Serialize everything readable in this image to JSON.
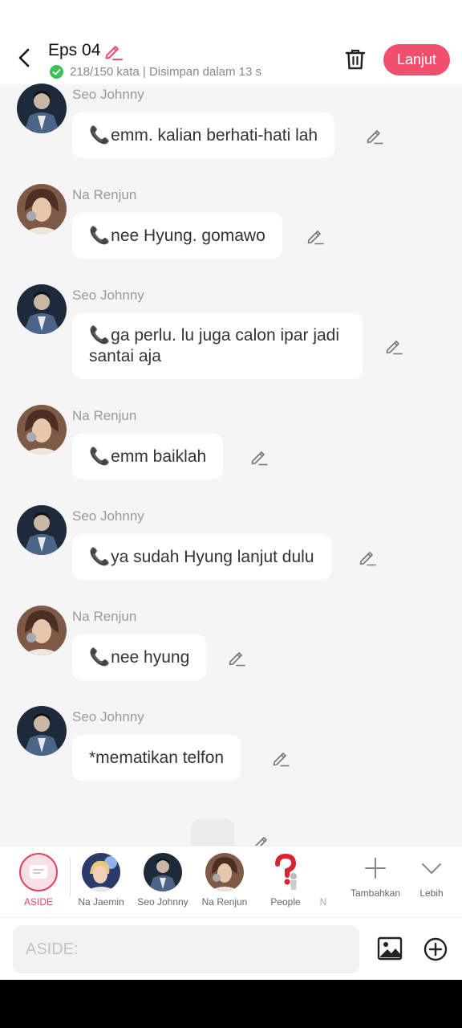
{
  "header": {
    "title": "Eps 04",
    "status": "218/150 kata | Disimpan dalam 13 s",
    "next_label": "Lanjut"
  },
  "messages": [
    {
      "sender": "Seo Johnny",
      "icon": "phone-emoji",
      "text": "emm. kalian berhati-hati lah"
    },
    {
      "sender": "Na Renjun",
      "icon": "phone-emoji",
      "text": "nee Hyung. gomawo"
    },
    {
      "sender": "Seo Johnny",
      "icon": "phone-emoji",
      "text": "ga perlu. lu juga calon ipar jadi santai aja"
    },
    {
      "sender": "Na Renjun",
      "icon": "phone-emoji",
      "text": "emm baiklah"
    },
    {
      "sender": "Seo Johnny",
      "icon": "phone-emoji",
      "text": "ya sudah Hyung lanjut dulu"
    },
    {
      "sender": "Na Renjun",
      "icon": "phone-emoji",
      "text": "nee hyung"
    },
    {
      "sender": "Seo Johnny",
      "icon": "",
      "text": "*mematikan telfon"
    }
  ],
  "characters": [
    {
      "label": "ASIDE",
      "selected": true
    },
    {
      "label": "Na Jaemin"
    },
    {
      "label": "Seo Johnny"
    },
    {
      "label": "Na Renjun"
    },
    {
      "label": "People"
    },
    {
      "label": "N"
    }
  ],
  "tools": {
    "add_label": "Tambahkan",
    "more_label": "Lebih"
  },
  "input": {
    "placeholder": "ASIDE:",
    "value": ""
  },
  "colors": {
    "accent": "#f0506e",
    "aside": "#e2455f",
    "background": "#f5f5f5"
  }
}
